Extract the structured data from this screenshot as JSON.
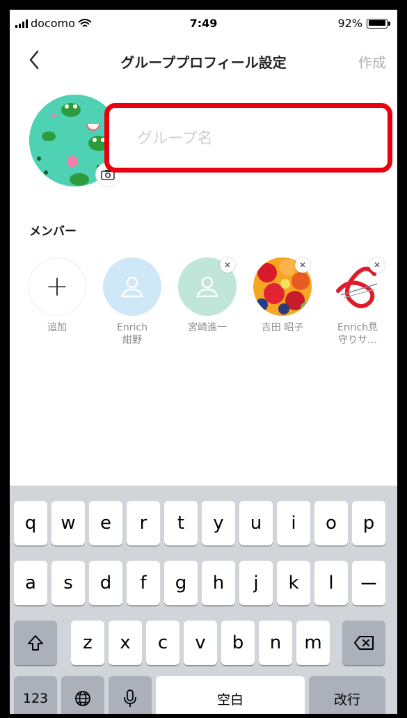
{
  "status_bar": {
    "carrier": "docomo",
    "time": "7:49",
    "battery": "92%"
  },
  "nav": {
    "title": "グループプロフィール設定",
    "action": "作成"
  },
  "group_name": {
    "value": "",
    "placeholder": "グループ名"
  },
  "members": {
    "title": "メンバー",
    "add_label": "追加",
    "items": [
      {
        "name": "Enrich\n紺野",
        "avatar": "default-user",
        "color": "#cfe8f8",
        "removable": false
      },
      {
        "name": "宮崎進一",
        "avatar": "default-user",
        "color": "#bfe6d8",
        "removable": true
      },
      {
        "name": "吉田 昭子",
        "avatar": "fruit-photo",
        "removable": true
      },
      {
        "name": "Enrich見\n守りサ…",
        "avatar": "red-logo",
        "removable": true
      }
    ]
  },
  "keyboard": {
    "row1": [
      "q",
      "w",
      "e",
      "r",
      "t",
      "y",
      "u",
      "i",
      "o",
      "p"
    ],
    "row2": [
      "a",
      "s",
      "d",
      "f",
      "g",
      "h",
      "j",
      "k",
      "l",
      "ー"
    ],
    "row3": [
      "z",
      "x",
      "c",
      "v",
      "b",
      "n",
      "m"
    ],
    "numbers_label": "123",
    "space_label": "空白",
    "return_label": "改行"
  },
  "colors": {
    "highlight": "#e8000f",
    "avatar_bg": "#4fd1b4",
    "keyboard_bg": "#d1d4d9"
  }
}
